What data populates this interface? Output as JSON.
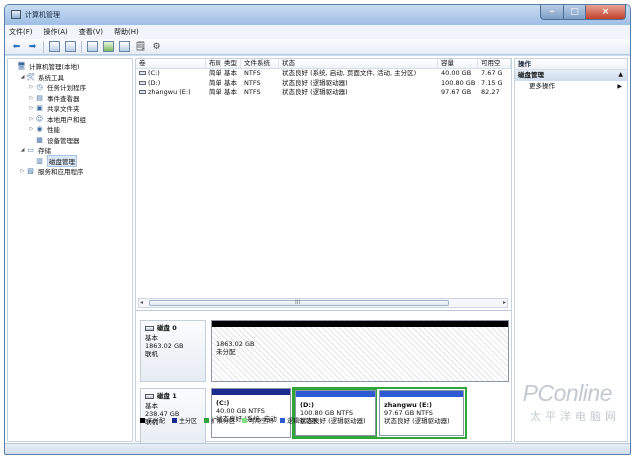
{
  "window": {
    "title": "计算机管理"
  },
  "menu": [
    "文件(F)",
    "操作(A)",
    "查看(V)",
    "帮助(H)"
  ],
  "toolbar_icons": [
    "back-arrow-icon",
    "forward-arrow-icon",
    "up-folder-icon",
    "show-hide-tree-icon",
    "help-icon",
    "refresh-icon",
    "properties-icon",
    "export-icon",
    "settings-icon"
  ],
  "tree": [
    {
      "label": "计算机管理(本地)",
      "icon": "computer-icon",
      "expander": "",
      "level": 0
    },
    {
      "label": "系统工具",
      "icon": "tools-icon",
      "expander": "◢",
      "level": 1
    },
    {
      "label": "任务计划程序",
      "icon": "clock-icon",
      "expander": "▷",
      "level": 2
    },
    {
      "label": "事件查看器",
      "icon": "event-viewer-icon",
      "expander": "▷",
      "level": 2
    },
    {
      "label": "共享文件夹",
      "icon": "shared-folder-icon",
      "expander": "▷",
      "level": 2
    },
    {
      "label": "本地用户和组",
      "icon": "users-icon",
      "expander": "▷",
      "level": 2
    },
    {
      "label": "性能",
      "icon": "performance-icon",
      "expander": "▷",
      "level": 2
    },
    {
      "label": "设备管理器",
      "icon": "device-manager-icon",
      "expander": "",
      "level": 2
    },
    {
      "label": "存储",
      "icon": "storage-icon",
      "expander": "◢",
      "level": 1
    },
    {
      "label": "磁盘管理",
      "icon": "disk-management-icon",
      "expander": "",
      "level": 2,
      "selected": true
    },
    {
      "label": "服务和应用程序",
      "icon": "services-icon",
      "expander": "▷",
      "level": 1
    }
  ],
  "volume_table": {
    "headers": [
      "卷",
      "布局",
      "类型",
      "文件系统",
      "状态",
      "容量",
      "可用空"
    ],
    "rows": [
      [
        "(C:)",
        "简单",
        "基本",
        "NTFS",
        "状态良好 (系统, 启动, 页面文件, 活动, 主分区)",
        "40.00 GB",
        "7.67 G"
      ],
      [
        "(D:)",
        "简单",
        "基本",
        "NTFS",
        "状态良好 (逻辑驱动器)",
        "100.80 GB",
        "7.15 G"
      ],
      [
        "zhangwu (E:)",
        "简单",
        "基本",
        "NTFS",
        "状态良好 (逻辑驱动器)",
        "97.67 GB",
        "82.27"
      ]
    ]
  },
  "disks": [
    {
      "name": "磁盘 0",
      "type": "基本",
      "size": "1863.02 GB",
      "status": "联机",
      "partitions": [
        {
          "name": "",
          "size": "1863.02 GB",
          "status": "未分配",
          "kind": "unallocated"
        }
      ]
    },
    {
      "name": "磁盘 1",
      "type": "基本",
      "size": "238.47 GB",
      "status": "联机",
      "partitions": [
        {
          "name": "(C:)",
          "size": "40.00 GB NTFS",
          "status": "状态良好 (系统, 启动",
          "kind": "primary"
        },
        {
          "name": "(D:)",
          "size": "100.80 GB NTFS",
          "status": "状态良好 (逻辑驱动器)",
          "kind": "logical"
        },
        {
          "name": "zhangwu (E:)",
          "size": "97.67 GB NTFS",
          "status": "状态良好 (逻辑驱动器)",
          "kind": "logical"
        }
      ]
    }
  ],
  "legend": [
    {
      "label": "未分配",
      "color": "#000000"
    },
    {
      "label": "主分区",
      "color": "#1b2a8f"
    },
    {
      "label": "扩展分区",
      "color": "#2fa53a"
    },
    {
      "label": "可用空间",
      "color": "#7ee07e"
    },
    {
      "label": "逻辑驱动器",
      "color": "#2e5ad2"
    }
  ],
  "actions": {
    "title": "操作",
    "section": "磁盘管理",
    "item": "更多操作"
  },
  "watermark": {
    "main": "PConline",
    "sub": "太平洋电脑网"
  }
}
